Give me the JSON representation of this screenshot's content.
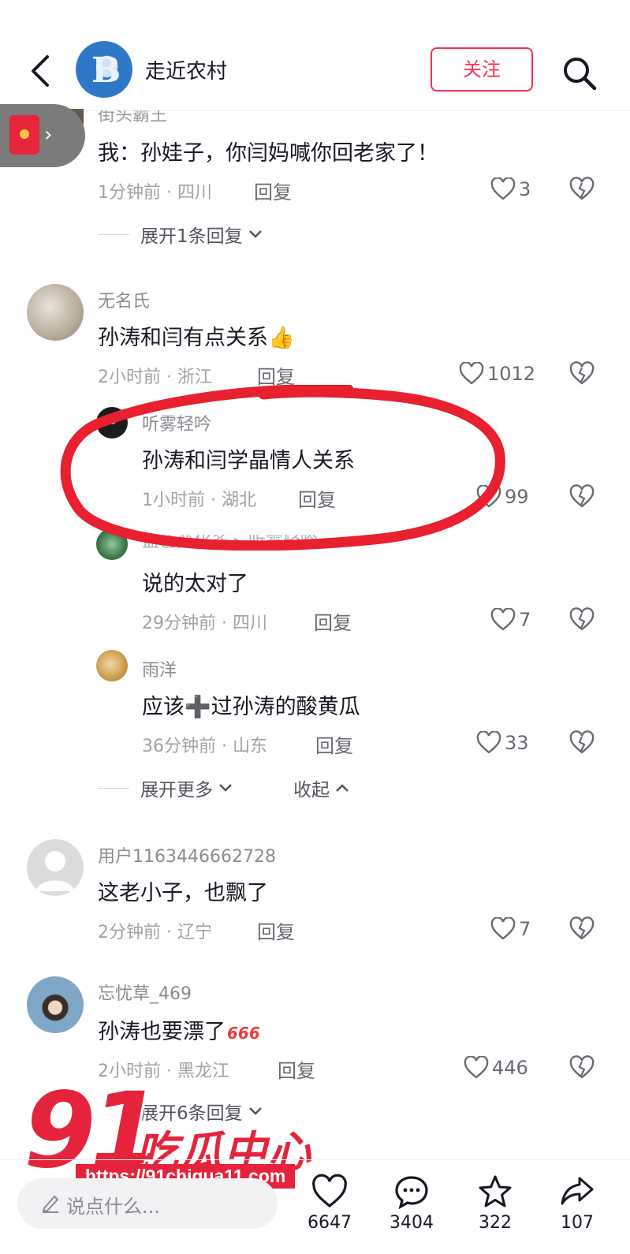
{
  "header": {
    "title": "走近农村",
    "follow_label": "关注"
  },
  "comments": [
    {
      "user": "街头霸王",
      "text": "我：孙娃子，你闫妈喊你回老家了！",
      "meta": "1分钟前 · 四川",
      "reply_label": "回复",
      "likes": "3",
      "expand_label": "展开1条回复"
    },
    {
      "user": "无名氏",
      "text": "孙涛和闫有点关系",
      "emoji": "👍",
      "meta": "2小时前 · 浙江",
      "reply_label": "回复",
      "likes": "1012"
    },
    {
      "user": "听雾轻吟",
      "text": "孙涛和闫学晶情人关系",
      "meta": "1小时前 · 湖北",
      "reply_label": "回复",
      "likes": "99"
    },
    {
      "user": "蓝色变化多 ▸ 听雾轻吟",
      "text": "说的太对了",
      "meta": "29分钟前 · 四川",
      "reply_label": "回复",
      "likes": "7"
    },
    {
      "user": "雨洋",
      "text": "应该➕过孙涛的酸黄瓜",
      "meta": "36分钟前 · 山东",
      "reply_label": "回复",
      "likes": "33",
      "expand_more_label": "展开更多",
      "collapse_label": "收起"
    },
    {
      "user": "用户1163446662728",
      "text": "这老小子，也飘了",
      "meta": "2分钟前 · 辽宁",
      "reply_label": "回复",
      "likes": "7"
    },
    {
      "user": "忘忧草_469",
      "text": "孙涛也要漂了",
      "badge": "666",
      "meta": "2小时前 · 黑龙江",
      "reply_label": "回复",
      "likes": "446",
      "expand_label": "展开6条回复"
    }
  ],
  "watermark": {
    "number": "91",
    "name": "吃瓜中心",
    "url": "https://91chigua11.com"
  },
  "bottom_bar": {
    "placeholder": "说点什么...",
    "likes": "6647",
    "comments": "3404",
    "favorites": "322",
    "shares": "107"
  },
  "colors": {
    "accent": "#fe2c55",
    "annotation": "#e8202f",
    "watermark": "#e5243b"
  },
  "icons": [
    "back-icon",
    "search-icon",
    "red-envelope-icon",
    "heart-icon",
    "dislike-icon",
    "chevron-down-icon",
    "chevron-up-icon",
    "pen-icon",
    "comment-icon",
    "star-icon",
    "share-icon"
  ]
}
